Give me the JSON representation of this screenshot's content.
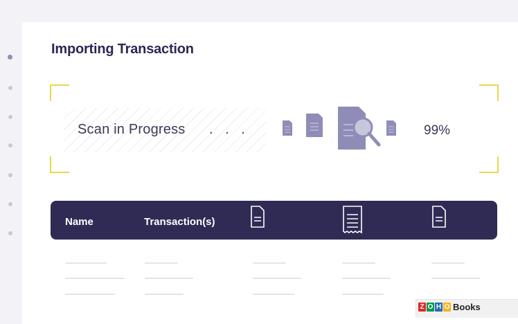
{
  "heading": "Importing Transaction",
  "scan": {
    "status_text": "Scan in Progress",
    "ellipsis": ". . .",
    "progress_percent_label": "99%",
    "progress_percent": 99
  },
  "table_header": {
    "name": "Name",
    "transactions": "Transaction(s)",
    "icons": [
      "document-icon",
      "receipt-icon",
      "document-icon"
    ]
  },
  "brand": {
    "zoho_letters": [
      "Z",
      "O",
      "H",
      "O"
    ],
    "zoho_colors": [
      "#e42527",
      "#089949",
      "#226db4",
      "#f9b21d"
    ],
    "product": "Books"
  },
  "colors": {
    "accent": "#2f2b55",
    "scan_frame": "#e8d84a",
    "doc_fill": "#8f8db8"
  }
}
